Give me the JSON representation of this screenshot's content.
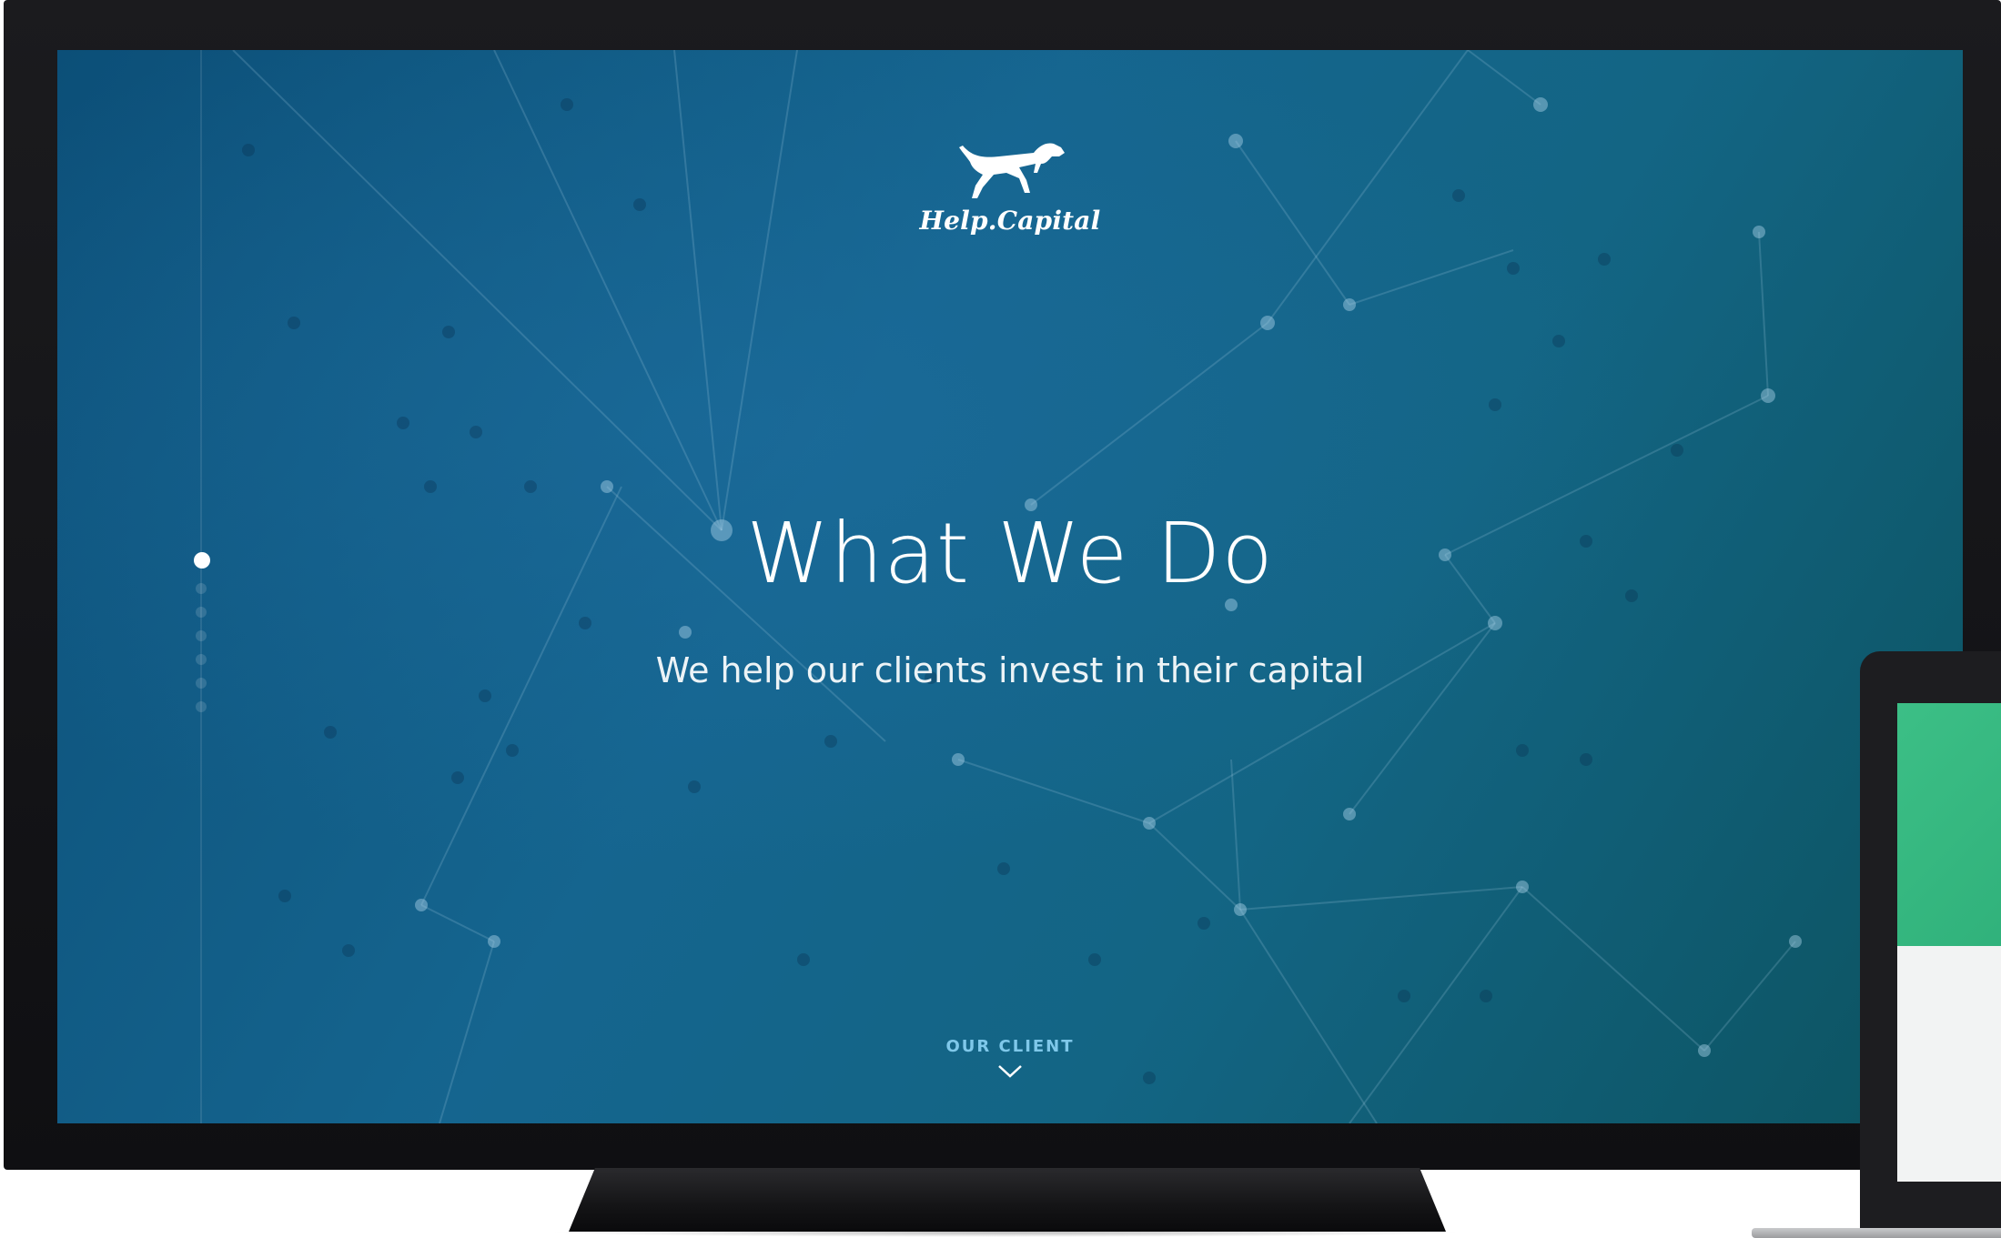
{
  "brand": {
    "name": "Help.Capital",
    "logo_icon": "pointer-dog-icon"
  },
  "hero": {
    "title": "What We Do",
    "subtitle": "We help our clients invest in their capital"
  },
  "scroll_cue": {
    "label": "OUR CLIENT",
    "icon": "chevron-down-icon"
  },
  "section_nav": {
    "count": 7,
    "active_index": 0
  },
  "colors": {
    "screen_bg_start": "#0c4f78",
    "screen_bg_end": "#0c5360",
    "accent_label": "#7fc8ea",
    "laptop_green": "#3cbf86"
  }
}
